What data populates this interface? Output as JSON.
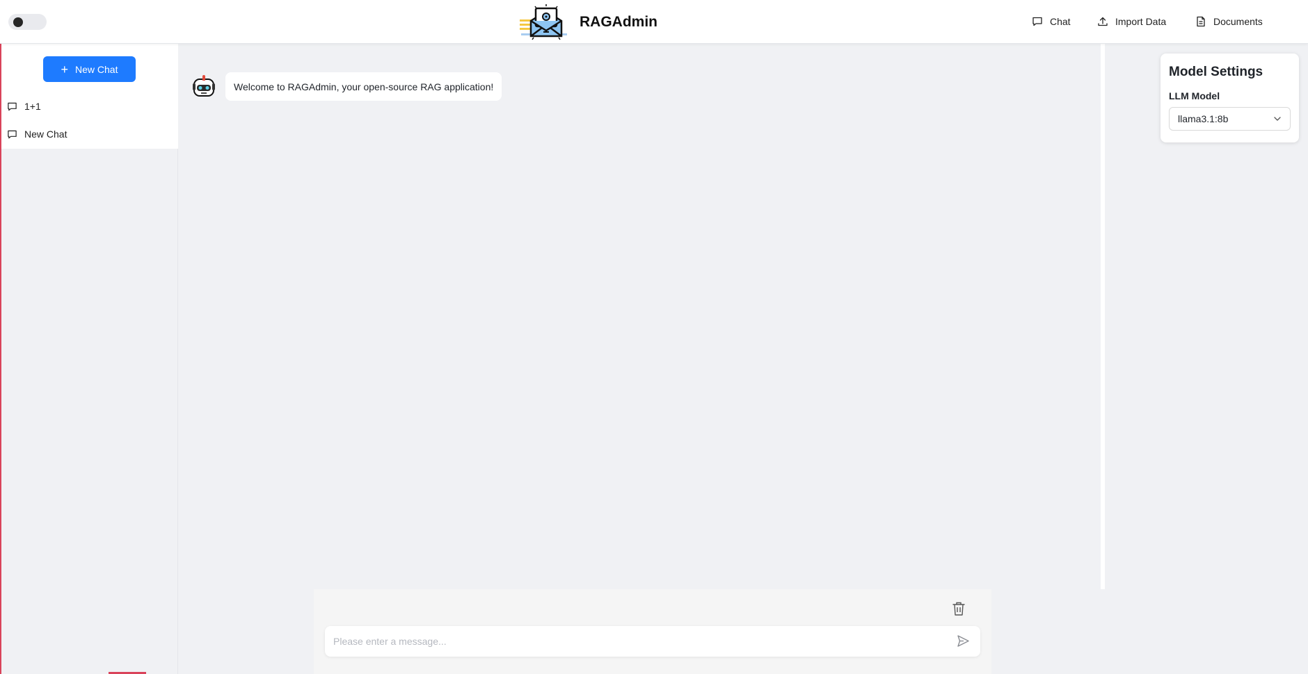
{
  "header": {
    "brand": "RAGAdmin",
    "nav": [
      {
        "label": "Chat",
        "icon": "chat-bubble-icon"
      },
      {
        "label": "Import Data",
        "icon": "upload-icon"
      },
      {
        "label": "Documents",
        "icon": "document-icon"
      }
    ],
    "theme_toggle": {
      "state": "off"
    }
  },
  "sidebar": {
    "new_chat_label": "New Chat",
    "conversations": [
      {
        "label": "1+1",
        "icon": "chat-bubble-icon"
      },
      {
        "label": "New Chat",
        "icon": "chat-bubble-icon"
      }
    ]
  },
  "chat": {
    "messages": [
      {
        "sender": "bot",
        "text": "Welcome to RAGAdmin, your open-source RAG application!"
      }
    ],
    "input": {
      "placeholder": "Please enter a message...",
      "value": ""
    }
  },
  "settings": {
    "title": "Model Settings",
    "llm_label": "LLM Model",
    "llm_value": "llama3.1:8b"
  },
  "colors": {
    "accent": "#1e7bff",
    "background": "#f0f1f4",
    "panel": "#ffffff"
  }
}
